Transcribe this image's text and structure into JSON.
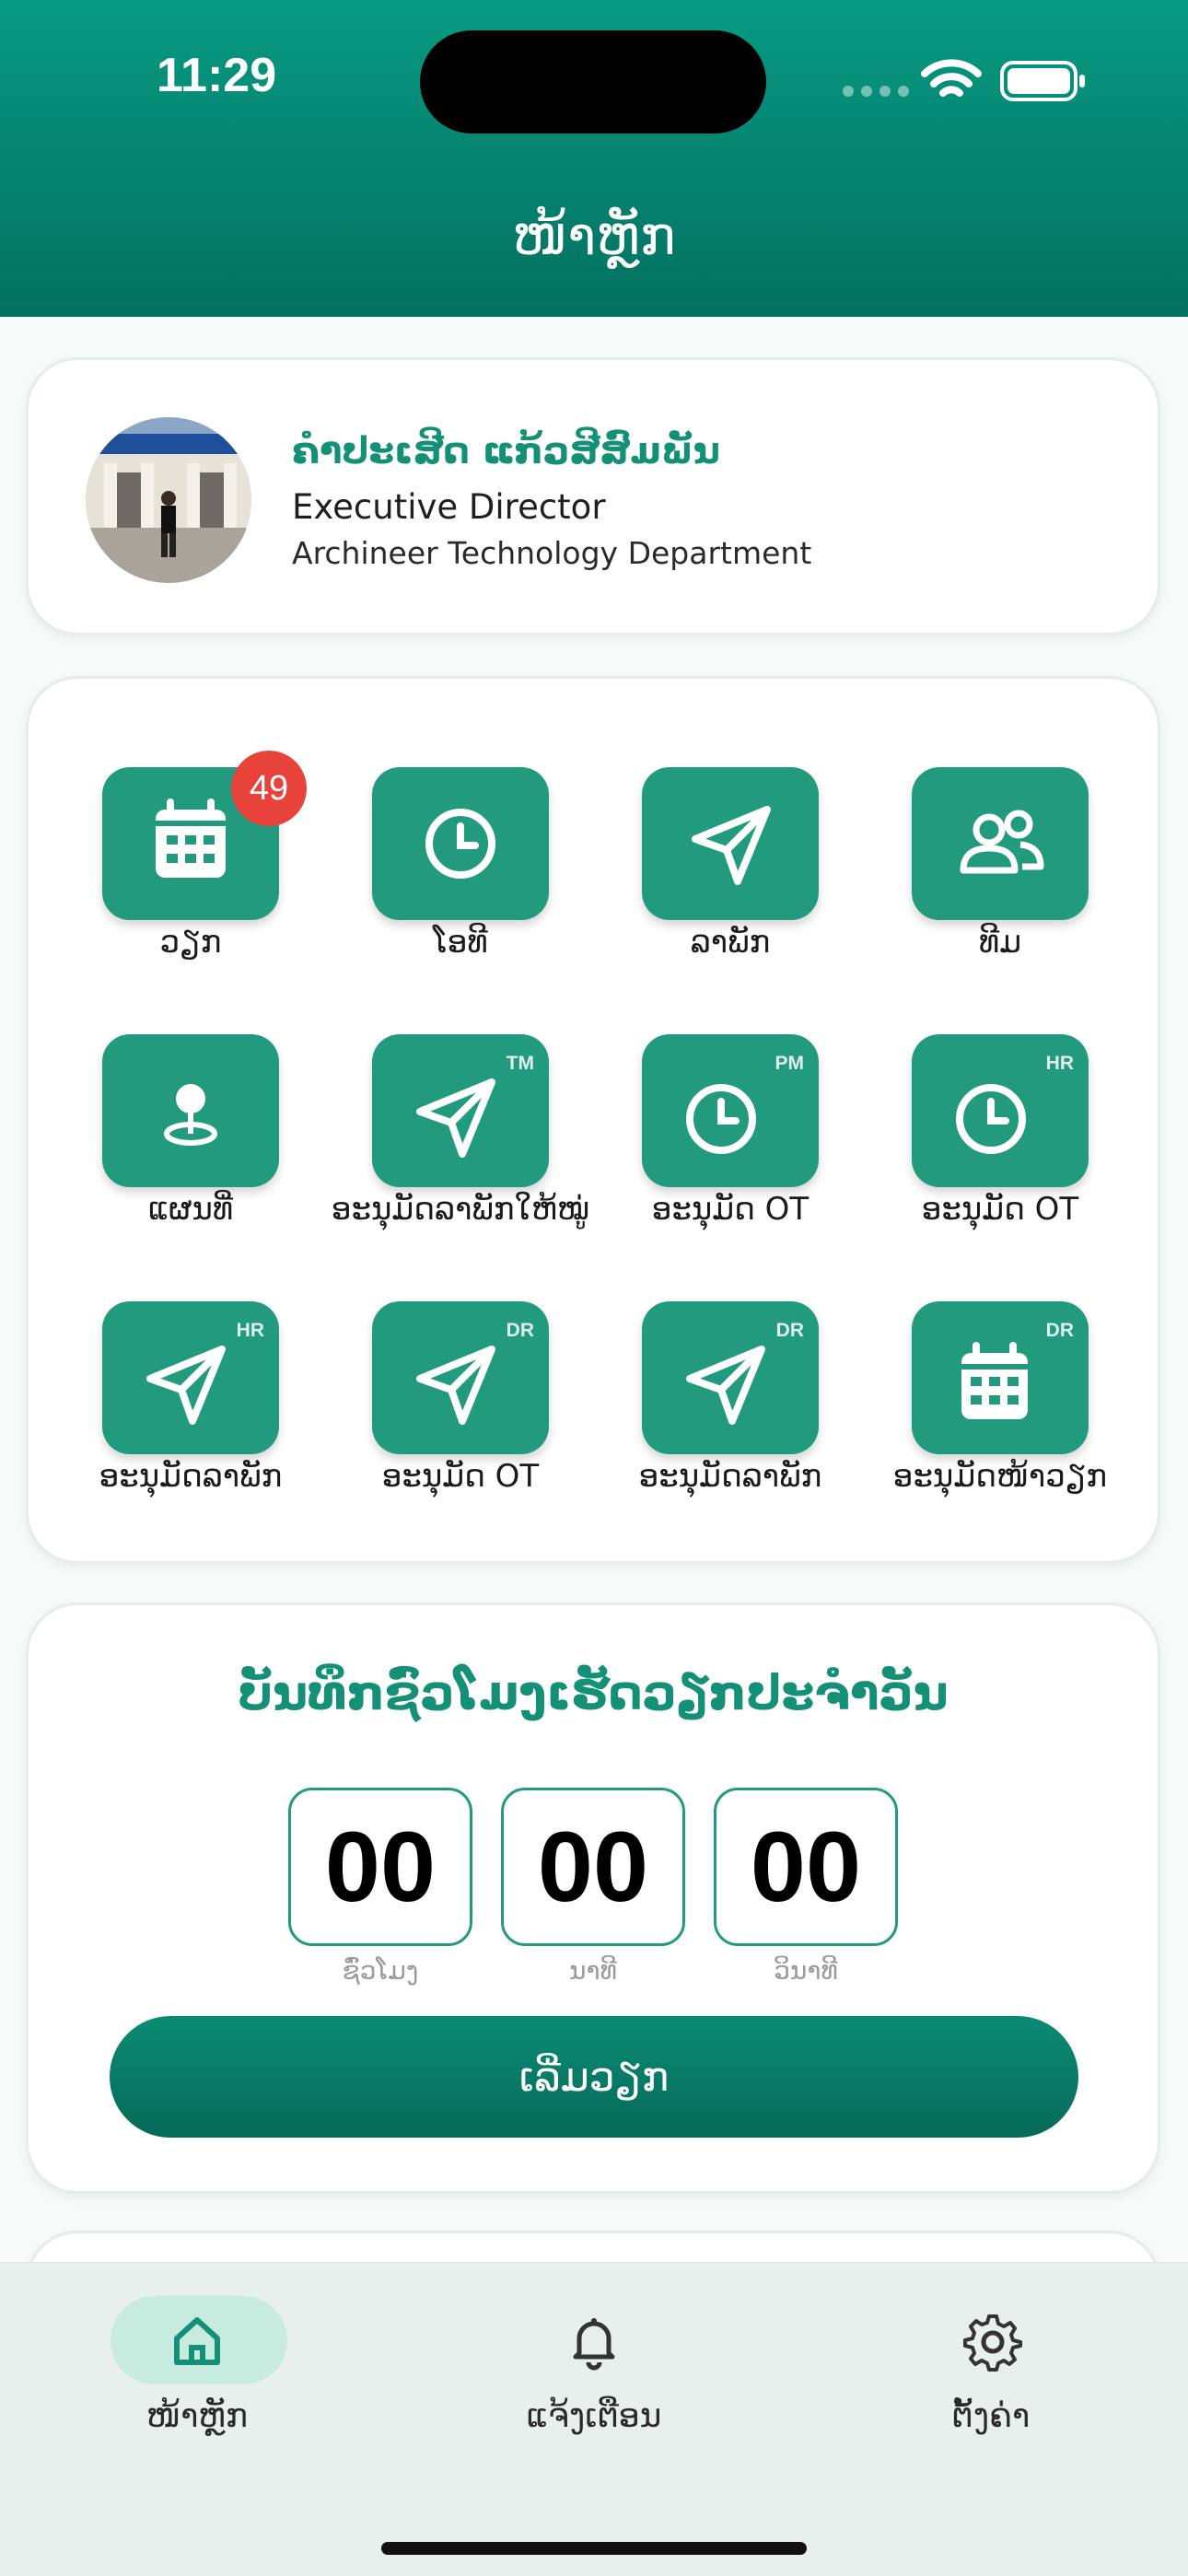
{
  "status_bar": {
    "time": "11:29"
  },
  "header": {
    "title": "ໜ້າຫຼັກ"
  },
  "profile": {
    "name": "ຄໍາປະເສີດ ແກ້ວສີສົມພັນ",
    "role": "Executive Director",
    "department": "Archineer Technology Department"
  },
  "menu": [
    {
      "label": "ວຽກ",
      "icon": "calendar-icon",
      "tag": "",
      "badge": "49"
    },
    {
      "label": "ໂອທີ",
      "icon": "clock-icon",
      "tag": "",
      "badge": ""
    },
    {
      "label": "ລາພັກ",
      "icon": "send-icon",
      "tag": "",
      "badge": ""
    },
    {
      "label": "ທີມ",
      "icon": "team-icon",
      "tag": "",
      "badge": ""
    },
    {
      "label": "ແຜນທີ່",
      "icon": "map-pin-icon",
      "tag": "",
      "badge": ""
    },
    {
      "label": "ອະນຸມັດລາພັກໃຫ້ໝູ່",
      "icon": "send-icon",
      "tag": "TM",
      "badge": ""
    },
    {
      "label": "ອະນຸມັດ OT",
      "icon": "clock-icon",
      "tag": "PM",
      "badge": ""
    },
    {
      "label": "ອະນຸມັດ OT",
      "icon": "clock-icon",
      "tag": "HR",
      "badge": ""
    },
    {
      "label": "ອະນຸມັດລາພັກ",
      "icon": "send-icon",
      "tag": "HR",
      "badge": ""
    },
    {
      "label": "ອະນຸມັດ OT",
      "icon": "send-icon",
      "tag": "DR",
      "badge": ""
    },
    {
      "label": "ອະນຸມັດລາພັກ",
      "icon": "send-icon",
      "tag": "DR",
      "badge": ""
    },
    {
      "label": "ອະນຸມັດໜ້າວຽກ",
      "icon": "calendar-icon",
      "tag": "DR",
      "badge": ""
    }
  ],
  "timer": {
    "title": "ບັນທຶກຊົ່ວໂມງເຮັດວຽກປະຈໍາວັນ",
    "hours": "00",
    "minutes": "00",
    "seconds": "00",
    "hours_label": "ຊົ່ວໂມງ",
    "minutes_label": "ນາທີ",
    "seconds_label": "ວິນາທີ",
    "start_label": "ເລີ່ມວຽກ"
  },
  "tabbar": [
    {
      "label": "ໜ້າຫຼັກ",
      "icon": "home-icon",
      "active": true
    },
    {
      "label": "ແຈ້ງເຕືອນ",
      "icon": "bell-icon",
      "active": false
    },
    {
      "label": "ຕັ້ງຄ່າ",
      "icon": "gear-icon",
      "active": false
    }
  ],
  "colors": {
    "primary": "#229a7d",
    "header": "#079a82",
    "accent_text": "#149077",
    "badge": "#e8433b"
  }
}
